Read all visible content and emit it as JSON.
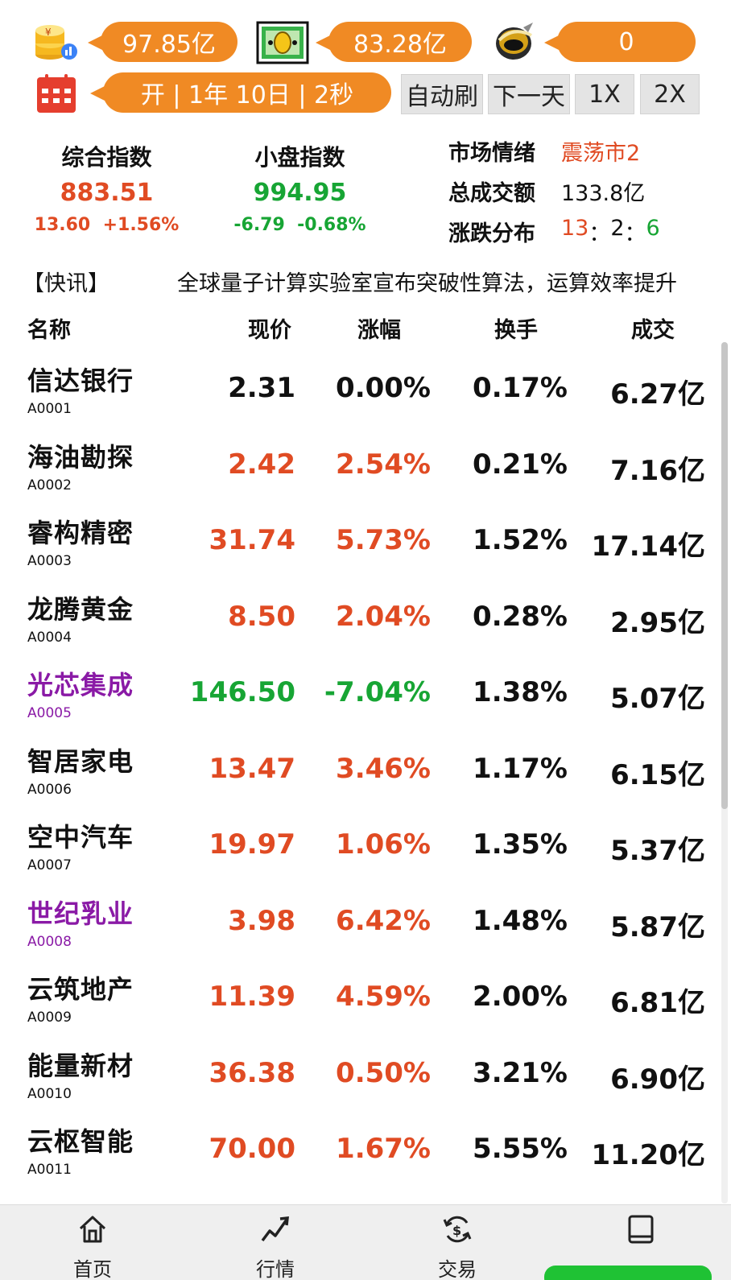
{
  "resources": {
    "cash": "97.85亿",
    "bill": "83.28亿",
    "gold": "0",
    "time": "开 | 1年 10日 | 2秒"
  },
  "controls": {
    "auto_refresh": "自动刷",
    "next_day": "下一天",
    "speed_1x": "1X",
    "speed_2x": "2X"
  },
  "indices": {
    "composite": {
      "title": "综合指数",
      "value": "883.51",
      "change": "13.60",
      "pct": "+1.56%"
    },
    "small_cap": {
      "title": "小盘指数",
      "value": "994.95",
      "change": "-6.79",
      "pct": "-0.68%"
    }
  },
  "market": {
    "sentiment_label": "市场情绪",
    "sentiment_value": "震荡市2",
    "turnover_label": "总成交额",
    "turnover_value": "133.8亿",
    "dist_label": "涨跌分布",
    "dist_up": "13",
    "dist_flat": "2",
    "dist_down": "6",
    "sep": "："
  },
  "news": {
    "tag": "【快讯】",
    "text": "全球量子计算实验室宣布突破性算法，运算效率提升"
  },
  "table": {
    "headers": {
      "name": "名称",
      "price": "现价",
      "change": "涨幅",
      "turnover": "换手",
      "volume": "成交"
    },
    "rows": [
      {
        "name": "信达银行",
        "code": "A0001",
        "price": "2.31",
        "change": "0.00%",
        "turnover": "0.17%",
        "volume": "6.27亿",
        "trend": "flat",
        "name_color": "normal"
      },
      {
        "name": "海油勘探",
        "code": "A0002",
        "price": "2.42",
        "change": "2.54%",
        "turnover": "0.21%",
        "volume": "7.16亿",
        "trend": "up",
        "name_color": "normal"
      },
      {
        "name": "睿构精密",
        "code": "A0003",
        "price": "31.74",
        "change": "5.73%",
        "turnover": "1.52%",
        "volume": "17.14亿",
        "trend": "up",
        "name_color": "normal"
      },
      {
        "name": "龙腾黄金",
        "code": "A0004",
        "price": "8.50",
        "change": "2.04%",
        "turnover": "0.28%",
        "volume": "2.95亿",
        "trend": "up",
        "name_color": "normal"
      },
      {
        "name": "光芯集成",
        "code": "A0005",
        "price": "146.50",
        "change": "-7.04%",
        "turnover": "1.38%",
        "volume": "5.07亿",
        "trend": "down",
        "name_color": "purple"
      },
      {
        "name": "智居家电",
        "code": "A0006",
        "price": "13.47",
        "change": "3.46%",
        "turnover": "1.17%",
        "volume": "6.15亿",
        "trend": "up",
        "name_color": "normal"
      },
      {
        "name": "空中汽车",
        "code": "A0007",
        "price": "19.97",
        "change": "1.06%",
        "turnover": "1.35%",
        "volume": "5.37亿",
        "trend": "up",
        "name_color": "normal"
      },
      {
        "name": "世纪乳业",
        "code": "A0008",
        "price": "3.98",
        "change": "6.42%",
        "turnover": "1.48%",
        "volume": "5.87亿",
        "trend": "up",
        "name_color": "purple"
      },
      {
        "name": "云筑地产",
        "code": "A0009",
        "price": "11.39",
        "change": "4.59%",
        "turnover": "2.00%",
        "volume": "6.81亿",
        "trend": "up",
        "name_color": "normal"
      },
      {
        "name": "能量新材",
        "code": "A0010",
        "price": "36.38",
        "change": "0.50%",
        "turnover": "3.21%",
        "volume": "6.90亿",
        "trend": "up",
        "name_color": "normal"
      },
      {
        "name": "云枢智能",
        "code": "A0011",
        "price": "70.00",
        "change": "1.67%",
        "turnover": "5.55%",
        "volume": "11.20亿",
        "trend": "up",
        "name_color": "normal"
      }
    ]
  },
  "nav": {
    "home": "首页",
    "market": "行情",
    "trade": "交易",
    "mine": ""
  },
  "colors": {
    "up": "#e04b23",
    "down": "#17a534",
    "flat": "#111111",
    "special": "#8a1aa6",
    "accent": "#f08a24"
  }
}
